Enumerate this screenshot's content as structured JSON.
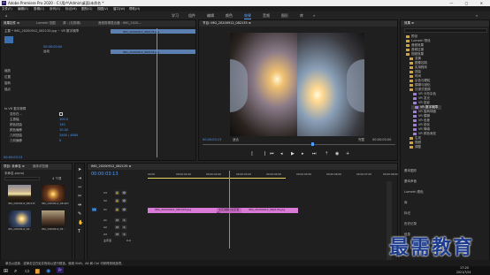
{
  "title": "Adobe Premiere Pro 2020 - C:\\用户\\Admin\\桌面\\未命名 *",
  "menu": [
    "文件(F)",
    "编辑(E)",
    "剪辑(C)",
    "序列(S)",
    "标记(M)",
    "图形(G)",
    "视图(V)",
    "窗口(W)",
    "帮助(H)"
  ],
  "workspaces": [
    "学习",
    "组件",
    "编辑",
    "颜色",
    "效果",
    "音频",
    "图形",
    "库",
    "»"
  ],
  "active_workspace": "效果",
  "effect_controls": {
    "tabs": [
      "效果控件 ≡",
      "Lumetri 范围",
      "源 : (无剪辑)",
      "音频剪辑混合器 : IMG_2020..."
    ],
    "clip_header": "主要 * IMG_20200912_082135.jpg ~ VR 数字故障",
    "section_motion": "运动",
    "param_rows": [
      "缩放",
      "位置",
      "旋转",
      "锚点"
    ],
    "time_value": "00:00:00:00",
    "section_vr": "fx  VR 数字故障",
    "vr_params": [
      {
        "label": "变形在...",
        "value": ""
      },
      {
        "label": "主振幅",
        "value": "100.0"
      },
      {
        "label": "颜色扭曲",
        "value": "150"
      },
      {
        "label": "颜色偏移",
        "value": "10.00"
      },
      {
        "label": "几何扭曲",
        "value": "2400 / 4800"
      },
      {
        "label": "几何偏移",
        "value": "0"
      }
    ],
    "timecode": "00:00:03:13",
    "clip_bar_label": "IMG_20200912_082135.jpg",
    "clip_bar_label2": "IMG_20200912_082135.jpg"
  },
  "program_monitor": {
    "tab": "节目: IMG_20200912_082135 ≡",
    "timecode_left": "00:00:03:13",
    "fit_label": "适合",
    "quality": "完整",
    "timecode_right": "00:00:05:00"
  },
  "effects_panel": {
    "title": "效果 ≡",
    "items": [
      "预设",
      "Lumetri 预设",
      "音频效果",
      "音频过渡",
      "视频效果",
      "变换",
      "图像控制",
      "实用程序",
      "扭曲",
      "时间",
      "杂色与颗粒",
      "模糊与锐化",
      "沉浸式视频",
      "VR 分形杂色",
      "VR 发光",
      "VR 投影",
      "VR 数字故障",
      "VR 旋转球面",
      "VR 模糊",
      "VR 色差",
      "VR 锐化",
      "VR 降噪",
      "VR 颜色渐变",
      "生成",
      "视频",
      "调整"
    ],
    "highlighted_item": "VR 数字故障",
    "bottom_sections": [
      "基本图形",
      "基本声音",
      "Lumetri 颜色",
      "库",
      "标记",
      "历史记录",
      "信息"
    ]
  },
  "project": {
    "tabs": [
      "项目: 未命名 ≡",
      "媒体浏览器"
    ],
    "path": "未命名.prproj",
    "item_count": "4 个项",
    "thumbs": [
      {
        "name": "IMG_20200912_082135",
        "dur": "5:00"
      },
      {
        "name": "IMG_20200912_081903",
        "dur": "5:00"
      },
      {
        "name": "IMG_20200912_08...",
        "dur": "5:00"
      },
      {
        "name": "IMG_20200912_08...",
        "dur": "5:00"
      }
    ]
  },
  "timeline": {
    "tab": "IMG_20200912_082135 ≡",
    "timecode": "00:00:03:13",
    "ruler": [
      "00:00",
      "00:00:01:00",
      "00:00:02:00",
      "00:00:03:00",
      "00:00:04:00",
      "00:00:05:00",
      "00:00:06:00",
      "00:00:07:00",
      "00:00:08:00"
    ],
    "tracks": [
      "V3",
      "V2",
      "V1",
      "A1",
      "A2",
      "A3",
      "主声道"
    ],
    "master_value": "0.0",
    "clip1": "IMG_20200912_081903.jpg",
    "clip2": "IMG_20200912_082135.jpg",
    "transition": "交叉溶解 (交叉溶解)"
  },
  "status_bar": "单击以选择，或单击空白处并拖动以进行框选。使用 Shift、Alt 和 Ctrl 可获得其他选项。",
  "watermark": "最需教育",
  "clock": {
    "time": "17:20",
    "date": "2021/7/24"
  },
  "colors": {
    "accent": "#4f9cff",
    "clip": "#d97ad6",
    "panel": "#1f1f1f"
  }
}
